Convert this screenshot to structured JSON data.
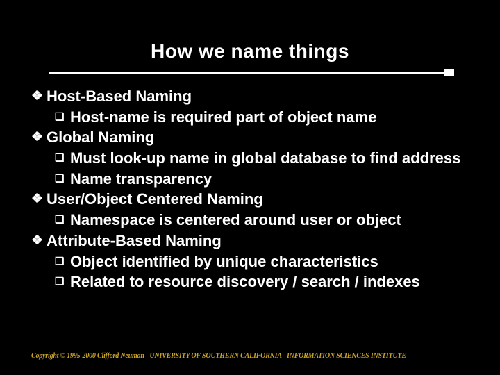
{
  "title": "How we name things",
  "bullets": [
    {
      "level": 1,
      "text": "Host-Based Naming"
    },
    {
      "level": 2,
      "text": "Host-name is required part of object name"
    },
    {
      "level": 1,
      "text": "Global Naming"
    },
    {
      "level": 2,
      "text": "Must look-up name in global database to find address"
    },
    {
      "level": 2,
      "text": "Name transparency"
    },
    {
      "level": 1,
      "text": "User/Object Centered Naming"
    },
    {
      "level": 2,
      "text": "Namespace is centered around user or object"
    },
    {
      "level": 1,
      "text": "Attribute-Based Naming"
    },
    {
      "level": 2,
      "text": "Object identified by unique characteristics"
    },
    {
      "level": 2,
      "text": "Related to resource discovery / search / indexes"
    }
  ],
  "glyphs": {
    "l1": "❖",
    "l2": "❑"
  },
  "footer": "Copyright © 1995-2000 Clifford Neuman - UNIVERSITY OF SOUTHERN CALIFORNIA - INFORMATION SCIENCES INSTITUTE"
}
